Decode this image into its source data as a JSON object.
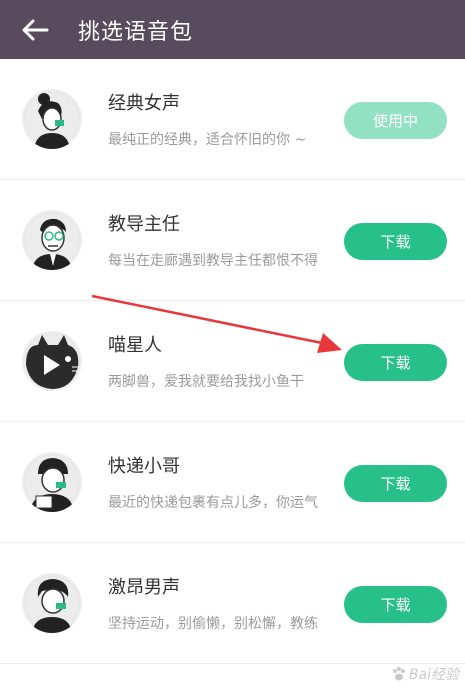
{
  "header": {
    "title": "挑选语音包",
    "back_icon": "back-arrow-icon"
  },
  "colors": {
    "header_bg": "#574b5d",
    "accent": "#27c08a",
    "accent_active": "#93e1c4"
  },
  "items": [
    {
      "name": "经典女声",
      "desc": "最纯正的经典，适合怀旧的你 ~",
      "button": "使用中",
      "avatar": "woman-avatar-icon"
    },
    {
      "name": "教导主任",
      "desc": "每当在走廊遇到教导主任都恨不得",
      "button": "下载",
      "avatar": "teacher-avatar-icon"
    },
    {
      "name": "喵星人",
      "desc": "两脚兽，爱我就要给我找小鱼干",
      "button": "下载",
      "avatar": "cat-avatar-icon"
    },
    {
      "name": "快递小哥",
      "desc": "最近的快递包裹有点儿多，你运气",
      "button": "下载",
      "avatar": "courier-avatar-icon"
    },
    {
      "name": "激昂男声",
      "desc": "坚持运动，别偷懒，别松懈，教练",
      "button": "下载",
      "avatar": "man-avatar-icon"
    }
  ],
  "watermark": "Bai经验"
}
